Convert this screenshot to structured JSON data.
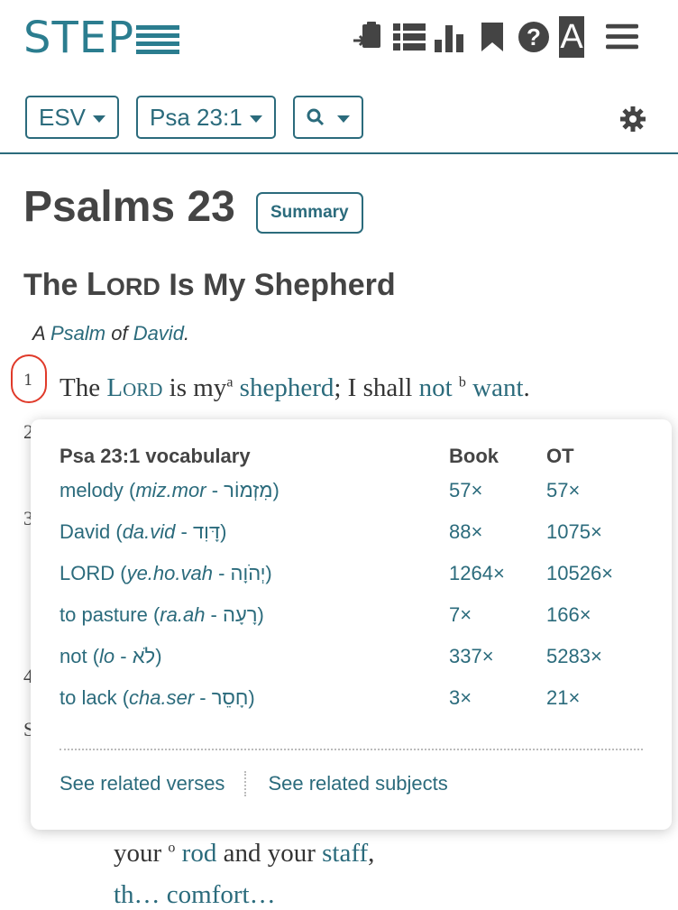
{
  "logo": {
    "text": "STEP"
  },
  "header": {
    "icons": [
      "copy-to-clipboard-icon",
      "list-icon",
      "bar-chart-icon",
      "bookmark-icon",
      "help-icon",
      "font-a-icon",
      "hamburger-menu-icon"
    ],
    "font_button_label": "A"
  },
  "toolbar": {
    "version_label": "ESV",
    "reference_label": "Psa 23:1",
    "search_icon": "search-icon",
    "settings_icon": "gear-icon"
  },
  "passage": {
    "chapter_title": "Psalms 23",
    "summary_label": "Summary",
    "heading_the": "The ",
    "heading_lord_L": "L",
    "heading_lord_rest": "ORD",
    "heading_rest": " Is My Shepherd",
    "subtitle_a": "A ",
    "subtitle_psalm": "Psalm",
    "subtitle_of": " of ",
    "subtitle_david": "David",
    "subtitle_dot": ".",
    "verse1": {
      "number": "1",
      "the": "The ",
      "lord_L": "L",
      "lord_rest": "ORD",
      "is_my": " is my",
      "note_a": "a",
      "shepherd": "shepherd",
      "i_shall": "; I shall ",
      "not": "not",
      "note_b": "b",
      "want": "want",
      "end": "."
    },
    "hidden_verse_numbers": [
      "2",
      "3",
      "4"
    ],
    "hidden_letter": "S",
    "verse4_line": {
      "your1": "your",
      "note_o": "o",
      "rod": "rod",
      "and_your": " and your ",
      "staff": "staff",
      "comma": ","
    },
    "verse4_next_partial": "th… comfort…"
  },
  "vocab_popup": {
    "title": "Psa 23:1 vocabulary",
    "col_book": "Book",
    "col_ot": "OT",
    "rows": [
      {
        "gloss": "melody (",
        "translit": "miz.mor",
        "sep": " - ",
        "hebrew": "מִזְמוֹר",
        "close": ")",
        "book": "57×",
        "ot": "57×"
      },
      {
        "gloss": "David (",
        "translit": "da.vid",
        "sep": " - ",
        "hebrew": "דָּוִד",
        "close": ")",
        "book": "88×",
        "ot": "1075×"
      },
      {
        "gloss": "LORD (",
        "translit": "ye.ho.vah",
        "sep": " - ",
        "hebrew": "יְהֹוָה",
        "close": ")",
        "book": "1264×",
        "ot": "10526×"
      },
      {
        "gloss": "to pasture (",
        "translit": "ra.ah",
        "sep": " - ",
        "hebrew": "רָעָה",
        "close": ")",
        "book": "7×",
        "ot": "166×"
      },
      {
        "gloss": "not (",
        "translit": "lo",
        "sep": " - ",
        "hebrew": "לֹא",
        "close": ")",
        "book": "337×",
        "ot": "5283×"
      },
      {
        "gloss": "to lack (",
        "translit": "cha.ser",
        "sep": " - ",
        "hebrew": "חָסֵר",
        "close": ")",
        "book": "3×",
        "ot": "21×"
      }
    ],
    "link_verses": "See related verses",
    "link_subjects": "See related subjects"
  },
  "colors": {
    "accent": "#2b6b7c",
    "logo": "#2b7d8f",
    "highlight_circle": "#e03a2a"
  }
}
